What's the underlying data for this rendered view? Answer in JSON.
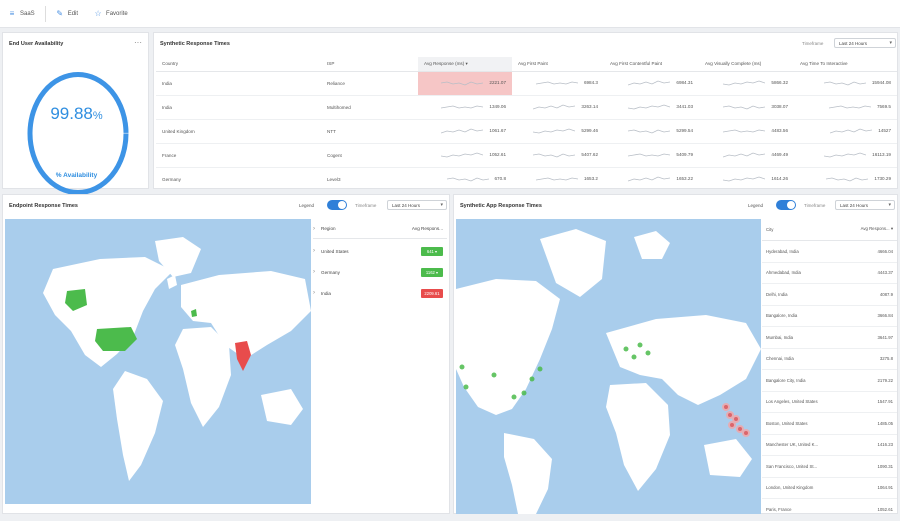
{
  "topbar": {
    "app": "SaaS",
    "edit": "Edit",
    "favorite": "Favorite"
  },
  "availability": {
    "title": "End User Availability",
    "value": "99.88",
    "unit": "%",
    "label": "% Availability",
    "fraction": 0.9988
  },
  "synthetic": {
    "title": "Synthetic Response Times",
    "timeframe_label": "Timeframe",
    "timeframe_value": "Last 24 Hours",
    "columns": [
      "Country",
      "ISP",
      "Avg Response (ms)",
      "Avg First Paint",
      "Avg First Contentful Paint",
      "Avg Visually Complete (ms)",
      "Avg Time To Interactive"
    ],
    "rows": [
      {
        "country": "India",
        "isp": "Reliance",
        "avg_response": "2221.07",
        "first_paint": "6984.3",
        "fcp": "6984.31",
        "visually_complete": "5866.32",
        "tti": "15944.08"
      },
      {
        "country": "India",
        "isp": "Multihomed",
        "avg_response": "1349.06",
        "first_paint": "3263.14",
        "fcp": "3441.03",
        "visually_complete": "3038.07",
        "tti": "7569.5"
      },
      {
        "country": "United Kingdom",
        "isp": "NTT",
        "avg_response": "1061.67",
        "first_paint": "5299.46",
        "fcp": "5299.54",
        "visually_complete": "4483.56",
        "tti": "14527"
      },
      {
        "country": "France",
        "isp": "Cogent",
        "avg_response": "1052.61",
        "first_paint": "5407.62",
        "fcp": "5409.79",
        "visually_complete": "4469.49",
        "tti": "16113.19"
      },
      {
        "country": "Germany",
        "isp": "Level3",
        "avg_response": "670.8",
        "first_paint": "1653.2",
        "fcp": "1653.22",
        "visually_complete": "1614.26",
        "tti": "1730.29"
      }
    ]
  },
  "endpoint": {
    "title": "Endpoint Response Times",
    "legend_label": "Legend",
    "timeframe_label": "Timeframe",
    "timeframe_value": "Last 24 Hours",
    "col_region": "Region",
    "col_avg": "Avg Respons...",
    "rows": [
      {
        "region": "United States",
        "value": "641 ▾",
        "status": "#4cbb4c"
      },
      {
        "region": "Germany",
        "value": "1162 ▾",
        "status": "#4cbb4c"
      },
      {
        "region": "India",
        "value": "2209.61",
        "status": "#e84c4c"
      }
    ]
  },
  "app": {
    "title": "Synthetic App Response Times",
    "legend_label": "Legend",
    "timeframe_label": "Timeframe",
    "timeframe_value": "Last 24 Hours",
    "col_city": "City",
    "col_avg": "Avg Respons...",
    "rows": [
      {
        "city": "Hyderabad, India",
        "value": "4666.04"
      },
      {
        "city": "Ahmedabad, India",
        "value": "4443.37"
      },
      {
        "city": "Delhi, India",
        "value": "4087.9"
      },
      {
        "city": "Bangalore, India",
        "value": "3666.84"
      },
      {
        "city": "Mumbai, India",
        "value": "3641.97"
      },
      {
        "city": "Chennai, India",
        "value": "3275.8"
      },
      {
        "city": "Bangalore City, India",
        "value": "2179.22"
      },
      {
        "city": "Los Angeles, United States",
        "value": "1547.91"
      },
      {
        "city": "Boston, United States",
        "value": "1485.05"
      },
      {
        "city": "Manchester UK, United K...",
        "value": "1416.23"
      },
      {
        "city": "San Francisco, United St...",
        "value": "1090.31"
      },
      {
        "city": "London, United Kingdom",
        "value": "1064.91"
      },
      {
        "city": "Paris, France",
        "value": "1052.61"
      }
    ]
  },
  "colors": {
    "accent": "#2f8ee0",
    "good": "#4cbb4c",
    "bad": "#e84c4c",
    "ocean": "#a9cdec",
    "land": "#ffffff"
  }
}
